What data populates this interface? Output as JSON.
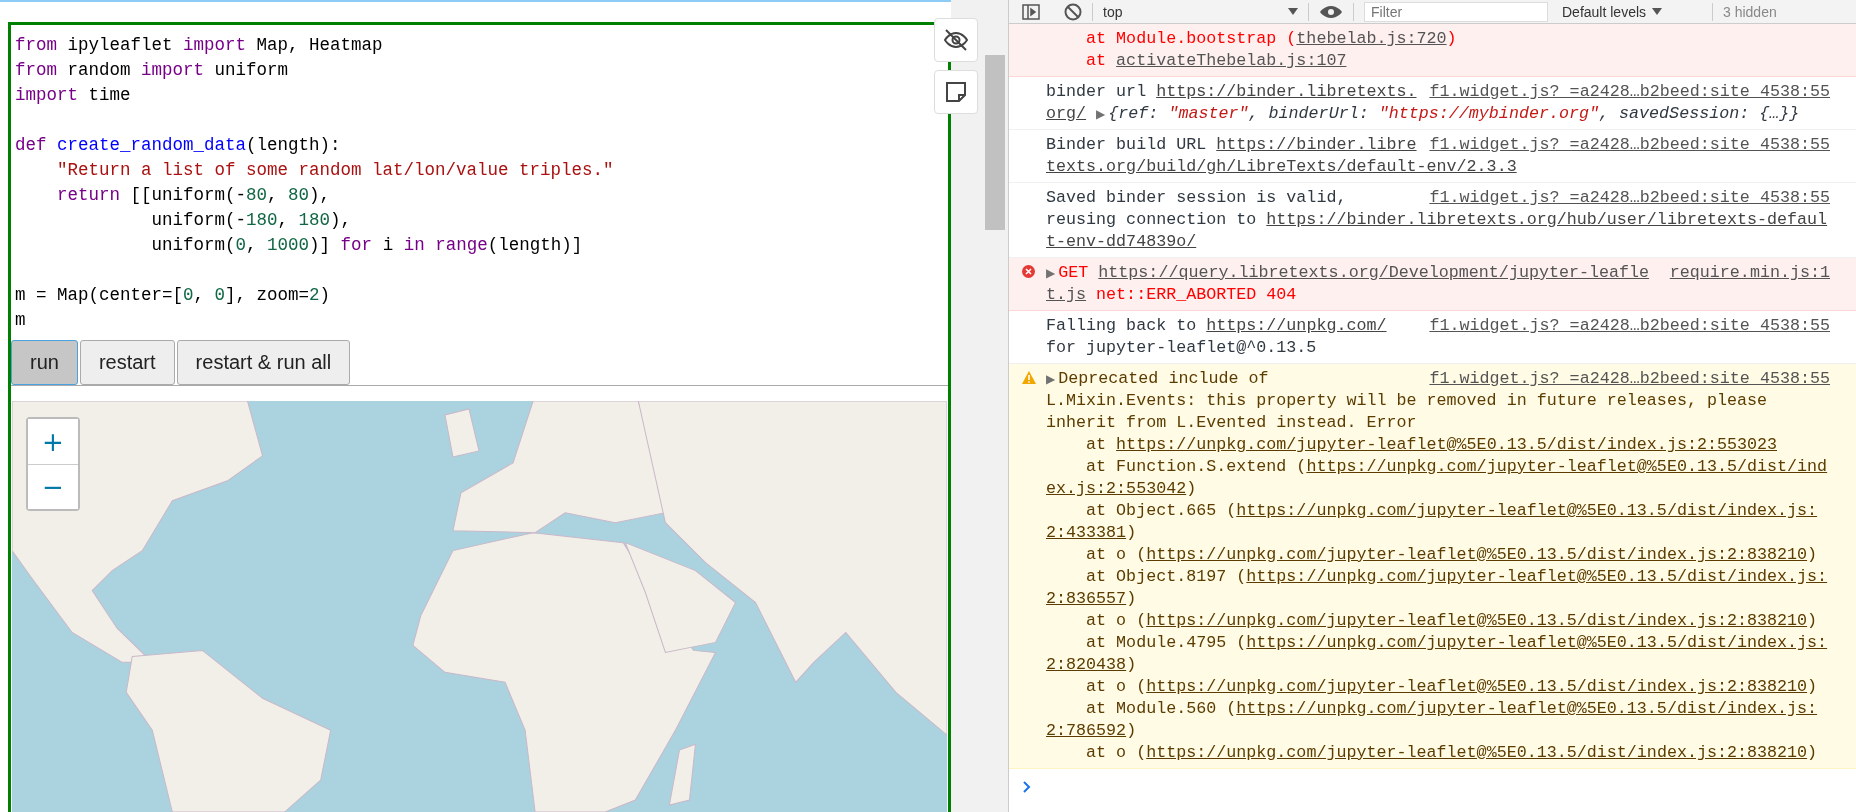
{
  "notebook": {
    "code_lines": [
      {
        "tokens": [
          {
            "kind": "kw",
            "text": "from"
          },
          {
            "kind": "plain",
            "text": " ipyleaflet "
          },
          {
            "kind": "kw",
            "text": "import"
          },
          {
            "kind": "plain",
            "text": " Map, Heatmap"
          }
        ]
      },
      {
        "tokens": [
          {
            "kind": "kw",
            "text": "from"
          },
          {
            "kind": "plain",
            "text": " random "
          },
          {
            "kind": "kw",
            "text": "import"
          },
          {
            "kind": "plain",
            "text": " uniform"
          }
        ]
      },
      {
        "tokens": [
          {
            "kind": "kw",
            "text": "import"
          },
          {
            "kind": "plain",
            "text": " time"
          }
        ]
      },
      {
        "blank_before": true,
        "tokens": [
          {
            "kind": "kw",
            "text": "def"
          },
          {
            "kind": "fn",
            "text": " create_random_data"
          },
          {
            "kind": "plain",
            "text": "(length):"
          }
        ]
      },
      {
        "tokens": [
          {
            "kind": "str",
            "text": "    \"Return a list of some random lat/lon/value triples.\""
          }
        ]
      },
      {
        "tokens": [
          {
            "kind": "kw",
            "text": "    return"
          },
          {
            "kind": "plain",
            "text": " [[uniform(-"
          },
          {
            "kind": "num",
            "text": "80"
          },
          {
            "kind": "plain",
            "text": ", "
          },
          {
            "kind": "num",
            "text": "80"
          },
          {
            "kind": "plain",
            "text": "),"
          }
        ]
      },
      {
        "tokens": [
          {
            "kind": "plain",
            "text": "             uniform(-"
          },
          {
            "kind": "num",
            "text": "180"
          },
          {
            "kind": "plain",
            "text": ", "
          },
          {
            "kind": "num",
            "text": "180"
          },
          {
            "kind": "plain",
            "text": "),"
          }
        ]
      },
      {
        "tokens": [
          {
            "kind": "plain",
            "text": "             uniform("
          },
          {
            "kind": "num",
            "text": "0"
          },
          {
            "kind": "plain",
            "text": ", "
          },
          {
            "kind": "num",
            "text": "1000"
          },
          {
            "kind": "plain",
            "text": ")] "
          },
          {
            "kind": "kw",
            "text": "for"
          },
          {
            "kind": "plain",
            "text": " i "
          },
          {
            "kind": "kw",
            "text": "in"
          },
          {
            "kind": "kw",
            "text": " range"
          },
          {
            "kind": "plain",
            "text": "(length)]"
          }
        ]
      },
      {
        "blank_before": true,
        "tokens": [
          {
            "kind": "plain",
            "text": "m = Map(center=["
          },
          {
            "kind": "num",
            "text": "0"
          },
          {
            "kind": "plain",
            "text": ", "
          },
          {
            "kind": "num",
            "text": "0"
          },
          {
            "kind": "plain",
            "text": "], zoom="
          },
          {
            "kind": "num",
            "text": "2"
          },
          {
            "kind": "plain",
            "text": ")"
          }
        ]
      },
      {
        "tokens": [
          {
            "kind": "plain",
            "text": "m"
          }
        ]
      }
    ],
    "buttons": [
      {
        "label": "run",
        "focused": true
      },
      {
        "label": "restart",
        "focused": false
      },
      {
        "label": "restart & run all",
        "focused": false
      }
    ],
    "map": {
      "kind": "picture",
      "zoom_in": "+",
      "zoom_out": "−"
    }
  },
  "console": {
    "toolbar": {
      "context": "top",
      "filter_placeholder": "Filter",
      "levels": "Default levels",
      "hidden_count": "3 hidden"
    },
    "messages": [
      {
        "kind": "error",
        "has_icon": false,
        "lines": [
          [
            {
              "kind": "text",
              "text": "    at Module.bootstrap ("
            },
            {
              "kind": "link",
              "text": "thebelab.js:720"
            },
            {
              "kind": "text",
              "text": ")"
            }
          ],
          [
            {
              "kind": "text",
              "text": "    at "
            },
            {
              "kind": "link",
              "text": "activateThebelab.js:107"
            }
          ]
        ]
      },
      {
        "kind": "info",
        "has_icon": false,
        "source": "f1.widget.js?_=a2428…b2beed:site_4538:55",
        "lines": [
          [
            {
              "kind": "text",
              "text": "binder url "
            },
            {
              "kind": "link",
              "text": "https://binder.libretexts."
            }
          ],
          [
            {
              "kind": "link",
              "text": "org/"
            },
            {
              "kind": "toggle",
              "text": "▶"
            },
            {
              "kind": "objkey",
              "text": "{ref: "
            },
            {
              "kind": "objstr",
              "text": "\"master\""
            },
            {
              "kind": "objkey",
              "text": ", binderUrl: "
            },
            {
              "kind": "objstr",
              "text": "\"https://mybinder.org\""
            },
            {
              "kind": "objkey",
              "text": ", savedSession: {…}}"
            }
          ]
        ]
      },
      {
        "kind": "info",
        "has_icon": false,
        "source": "f1.widget.js?_=a2428…b2beed:site_4538:55",
        "lines": [
          [
            {
              "kind": "text",
              "text": "Binder build URL "
            },
            {
              "kind": "link",
              "text": "https://binder.libre"
            }
          ],
          [
            {
              "kind": "link",
              "text": "texts.org/build/gh/LibreTexts/default-env/2.3.3"
            }
          ]
        ]
      },
      {
        "kind": "info",
        "has_icon": false,
        "source": "f1.widget.js?_=a2428…b2beed:site_4538:55",
        "lines": [
          [
            {
              "kind": "text",
              "text": "Saved binder session is valid,"
            }
          ],
          [
            {
              "kind": "text",
              "text": "reusing connection to "
            },
            {
              "kind": "link",
              "text": "https://binder.libretexts.org/hub/user/libretexts-defaul"
            }
          ],
          [
            {
              "kind": "link",
              "text": "t-env-dd74839o/"
            }
          ]
        ]
      },
      {
        "kind": "error",
        "has_icon": true,
        "source": "require.min.js:1",
        "lines": [
          [
            {
              "kind": "toggle",
              "text": "▶"
            },
            {
              "kind": "text",
              "text": "GET "
            },
            {
              "kind": "link",
              "text": "https://query.libretexts.org/Development/jupyter-leafle"
            }
          ],
          [
            {
              "kind": "link",
              "text": "t.js"
            },
            {
              "kind": "text",
              "text": " net::ERR_ABORTED 404"
            }
          ]
        ]
      },
      {
        "kind": "info",
        "has_icon": false,
        "source": "f1.widget.js?_=a2428…b2beed:site_4538:55",
        "lines": [
          [
            {
              "kind": "text",
              "text": "Falling back to "
            },
            {
              "kind": "link",
              "text": "https://unpkg.com/"
            }
          ],
          [
            {
              "kind": "text",
              "text": "for jupyter-leaflet@^0.13.5"
            }
          ]
        ]
      },
      {
        "kind": "warning",
        "has_icon": true,
        "source": "f1.widget.js?_=a2428…b2beed:site_4538:55",
        "lines": [
          [
            {
              "kind": "toggle",
              "text": "▶"
            },
            {
              "kind": "text",
              "text": "Deprecated include of"
            }
          ],
          [
            {
              "kind": "text",
              "text": "L.Mixin.Events: this property will be removed in future releases, please"
            }
          ],
          [
            {
              "kind": "text",
              "text": "inherit from L.Evented instead. Error"
            }
          ],
          [
            {
              "kind": "text",
              "text": "    at "
            },
            {
              "kind": "link",
              "text": "https://unpkg.com/jupyter-leaflet@%5E0.13.5/dist/index.js:2:553023"
            }
          ],
          [
            {
              "kind": "text",
              "text": "    at Function.S.extend ("
            },
            {
              "kind": "link",
              "text": "https://unpkg.com/jupyter-leaflet@%5E0.13.5/dist/ind"
            }
          ],
          [
            {
              "kind": "link",
              "text": "ex.js:2:553042"
            },
            {
              "kind": "text",
              "text": ")"
            }
          ],
          [
            {
              "kind": "text",
              "text": "    at Object.665 ("
            },
            {
              "kind": "link",
              "text": "https://unpkg.com/jupyter-leaflet@%5E0.13.5/dist/index.js:"
            }
          ],
          [
            {
              "kind": "link",
              "text": "2:433381"
            },
            {
              "kind": "text",
              "text": ")"
            }
          ],
          [
            {
              "kind": "text",
              "text": "    at o ("
            },
            {
              "kind": "link",
              "text": "https://unpkg.com/jupyter-leaflet@%5E0.13.5/dist/index.js:2:838210"
            },
            {
              "kind": "text",
              "text": ")"
            }
          ],
          [
            {
              "kind": "text",
              "text": "    at Object.8197 ("
            },
            {
              "kind": "link",
              "text": "https://unpkg.com/jupyter-leaflet@%5E0.13.5/dist/index.js:"
            }
          ],
          [
            {
              "kind": "link",
              "text": "2:836557"
            },
            {
              "kind": "text",
              "text": ")"
            }
          ],
          [
            {
              "kind": "text",
              "text": "    at o ("
            },
            {
              "kind": "link",
              "text": "https://unpkg.com/jupyter-leaflet@%5E0.13.5/dist/index.js:2:838210"
            },
            {
              "kind": "text",
              "text": ")"
            }
          ],
          [
            {
              "kind": "text",
              "text": "    at Module.4795 ("
            },
            {
              "kind": "link",
              "text": "https://unpkg.com/jupyter-leaflet@%5E0.13.5/dist/index.js:"
            }
          ],
          [
            {
              "kind": "link",
              "text": "2:820438"
            },
            {
              "kind": "text",
              "text": ")"
            }
          ],
          [
            {
              "kind": "text",
              "text": "    at o ("
            },
            {
              "kind": "link",
              "text": "https://unpkg.com/jupyter-leaflet@%5E0.13.5/dist/index.js:2:838210"
            },
            {
              "kind": "text",
              "text": ")"
            }
          ],
          [
            {
              "kind": "text",
              "text": "    at Module.560 ("
            },
            {
              "kind": "link",
              "text": "https://unpkg.com/jupyter-leaflet@%5E0.13.5/dist/index.js:"
            }
          ],
          [
            {
              "kind": "link",
              "text": "2:786592"
            },
            {
              "kind": "text",
              "text": ")"
            }
          ],
          [
            {
              "kind": "text",
              "text": "    at o ("
            },
            {
              "kind": "link",
              "text": "https://unpkg.com/jupyter-leaflet@%5E0.13.5/dist/index.js:2:838210"
            },
            {
              "kind": "text",
              "text": ")"
            }
          ]
        ]
      }
    ]
  }
}
